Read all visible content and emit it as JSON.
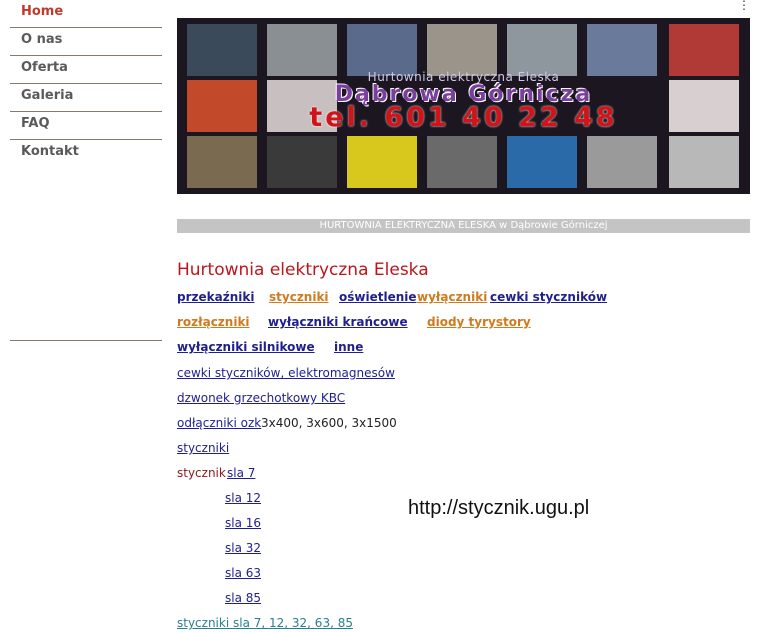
{
  "nav": {
    "items": [
      {
        "label": "Home"
      },
      {
        "label": "O nas"
      },
      {
        "label": "Oferta"
      },
      {
        "label": "Galeria"
      },
      {
        "label": "FAQ"
      },
      {
        "label": "Kontakt"
      }
    ]
  },
  "banner": {
    "line1": "Hurtownia elektryczna Eleska",
    "line2": "Dąbrowa Górnicza",
    "line3": "tel. 601 40 22 48"
  },
  "strip_text": "HURTOWNIA ELEKTRYCZNA ELESKA w Dąbrowie Górniczej",
  "heading": "Hurtownia elektryczna Eleska",
  "categories": {
    "row1": [
      "przekaźniki",
      "styczniki",
      "oświetlenie",
      "wyłączniki",
      "cewki styczników"
    ],
    "row2": [
      "rozłączniki",
      "wyłączniki krańcowe",
      "diody tyrystory"
    ],
    "row3": [
      "wyłączniki silnikowe",
      "inne"
    ]
  },
  "links": {
    "cewki": "cewki styczników, elektromagnesów",
    "dzwonek": "dzwonek grzechotkowy KBC",
    "odlaczniki": "odłączniki ozk",
    "odlaczniki_sizes": "3x400, 3x600, 3x1500",
    "styczniki": "styczniki",
    "stycznik_label": "stycznik",
    "sla": [
      "sla 7",
      "sla 12",
      "sla 16",
      "sla 32",
      "sla 63",
      "sla 85"
    ],
    "styczniki_sla": "styczniki sla 7, 12, 32, 63, 85"
  },
  "watermark": "http://stycznik.ugu.pl",
  "corner_mark": "⋮",
  "colors": {
    "accent": "#c0141a",
    "link_navy": "#1f1f8f",
    "link_orange": "#d07a1e",
    "strip": "#c4c4c4"
  }
}
